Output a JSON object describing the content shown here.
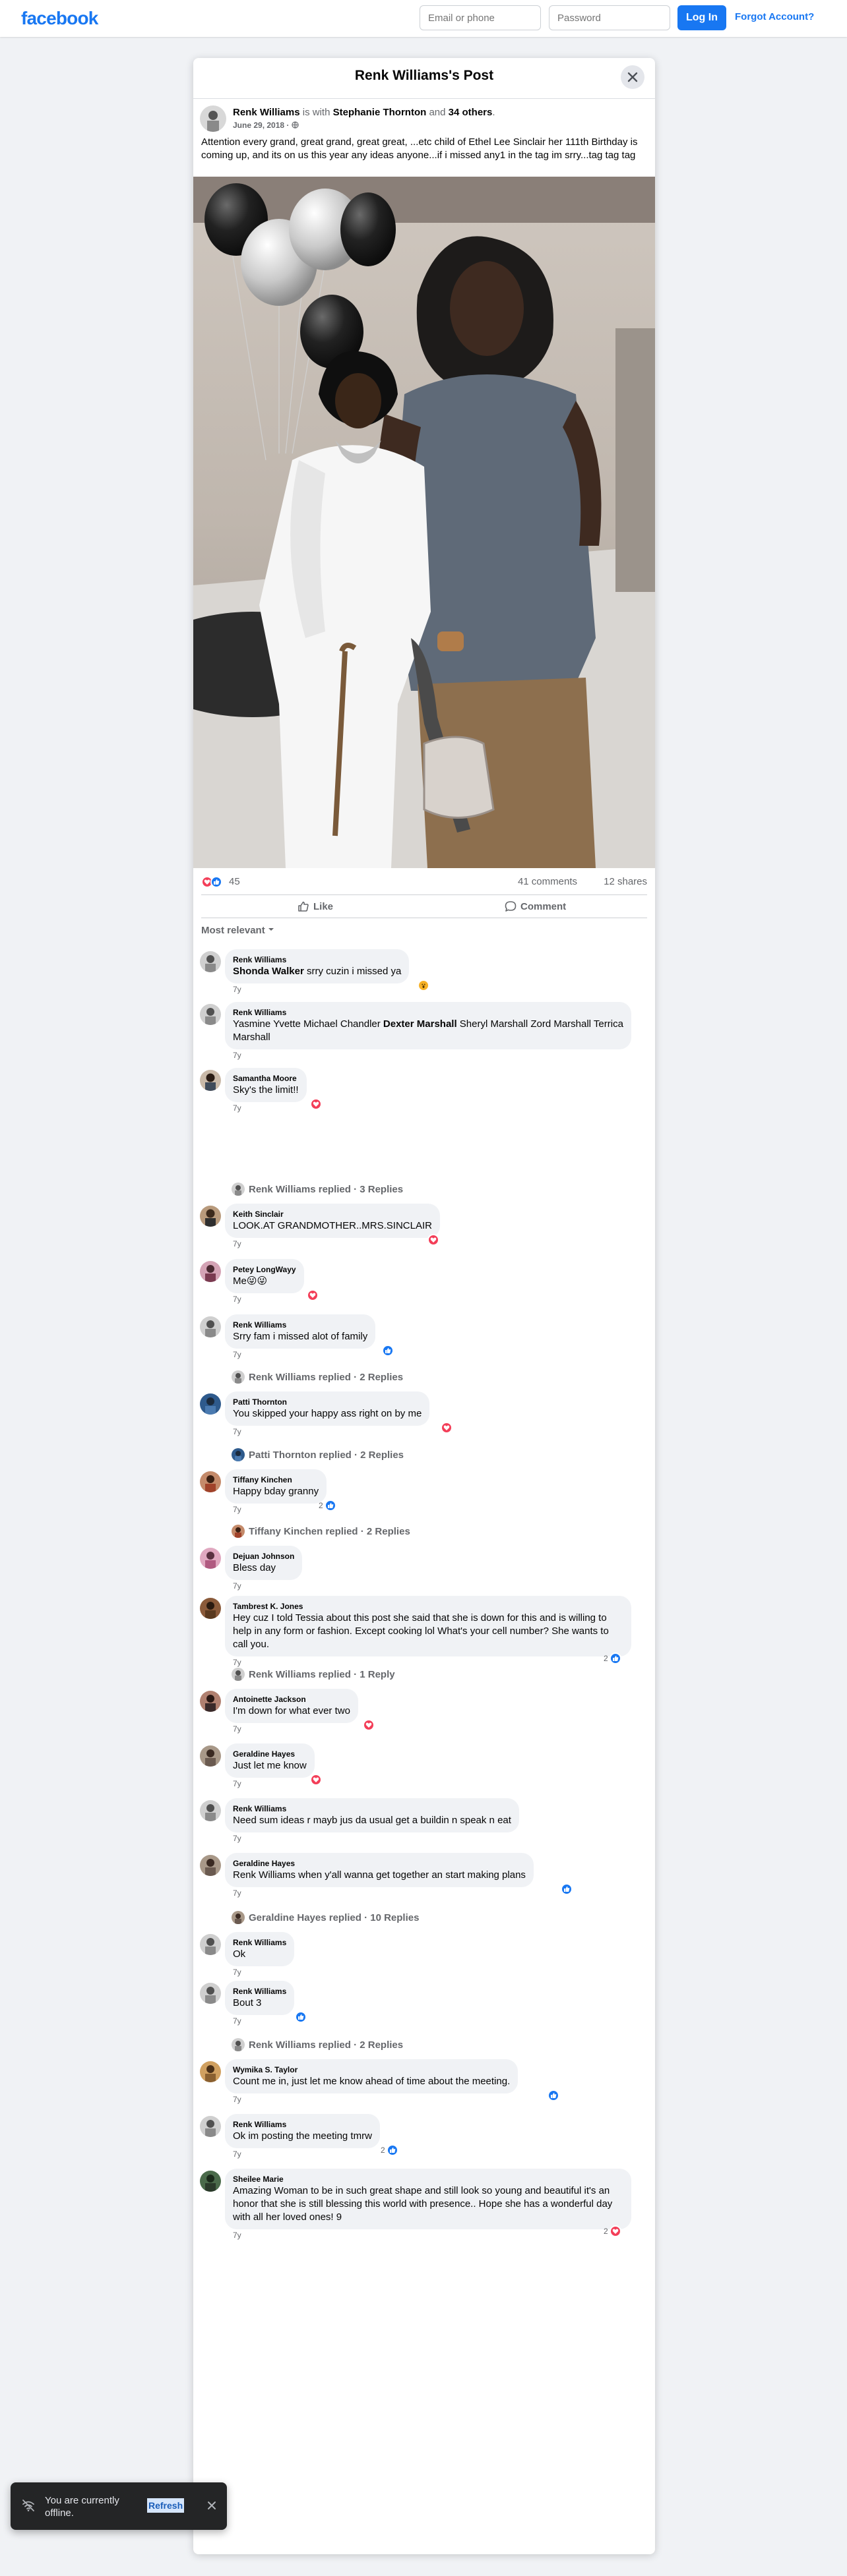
{
  "topbar": {
    "logo": "facebook",
    "email_placeholder": "Email or phone",
    "password_placeholder": "Password",
    "login_label": "Log In",
    "forgot_label": "Forgot Account?"
  },
  "post": {
    "title": "Renk Williams's Post",
    "author": "Renk Williams",
    "with_word": "is with",
    "tagged": "Stephanie Thornton",
    "and_word": "and",
    "others": "34 others",
    "date": "June 29, 2018",
    "text": "Attention every grand, great grand, great great, ...etc child of Ethel Lee Sinclair her 111th  Birthday is coming up, and its on us this year  any ideas anyone...if i missed any1 in the tag im srry...tag tag tag",
    "reaction_count": "45",
    "comments_count": "41 comments",
    "shares_count": "12 shares",
    "like_label": "Like",
    "comment_label": "Comment",
    "sort_label": "Most relevant"
  },
  "comments": [
    {
      "name": "Renk Williams",
      "mention": "Shonda Walker",
      "text": " srry cuzin i missed ya",
      "time": "7y",
      "reaction": "wow"
    },
    {
      "name": "Renk Williams",
      "text_a": "Yasmine Yvette Michael Chandler ",
      "mention": "Dexter Marshall",
      "text_b": " Sheryl Marshall Zord Marshall Terrica Marshall",
      "time": "7y"
    },
    {
      "name": "Samantha Moore",
      "text": "Sky's the limit!!",
      "time": "7y",
      "reaction": "love"
    },
    {
      "name": "Keith Sinclair",
      "text": "LOOK.AT GRANDMOTHER..MRS.SINCLAIR",
      "time": "7y",
      "reaction": "love"
    },
    {
      "name": "Petey LongWayy",
      "text": "Me😜😜",
      "time": "7y",
      "reaction": "love"
    },
    {
      "name": "Renk Williams",
      "text": "Srry fam i missed alot of family",
      "time": "7y",
      "reaction": "like"
    },
    {
      "name": "Patti Thornton",
      "text": "You skipped your happy ass right on by me",
      "time": "7y",
      "reaction": "love"
    },
    {
      "name": "Tiffany Kinchen",
      "text": "Happy bday granny",
      "time": "7y",
      "reaction": "like",
      "reaction_count": "2"
    },
    {
      "name": "Dejuan Johnson",
      "text": "Bless day",
      "time": "7y"
    },
    {
      "name": "Tambrest K. Jones",
      "text": "Hey cuz I told Tessia about this post she said that she is down for this and is willing to help in any form or fashion. Except cooking lol What's your cell number? She wants to call you.",
      "time": "7y",
      "reaction": "like",
      "reaction_count": "2"
    },
    {
      "name": "Antoinette Jackson",
      "text": "I'm down for what ever two",
      "time": "7y",
      "reaction": "love"
    },
    {
      "name": "Geraldine Hayes",
      "text": "Just let me know",
      "time": "7y",
      "reaction": "love"
    },
    {
      "name": "Renk Williams",
      "text": "Need sum ideas r mayb jus da usual get a buildin n speak n eat",
      "time": "7y"
    },
    {
      "name": "Geraldine Hayes",
      "text": "Renk Williams when y'all wanna get together an start making plans",
      "time": "7y",
      "reaction": "like"
    },
    {
      "name": "Renk Williams",
      "text": "Ok",
      "time": "7y"
    },
    {
      "name": "Renk Williams",
      "text": "Bout 3",
      "time": "7y",
      "reaction": "like"
    },
    {
      "name": "Wymika S. Taylor",
      "text": "Count me in, just let me know ahead of time about the meeting.",
      "time": "7y",
      "reaction": "like"
    },
    {
      "name": "Renk Williams",
      "text": "Ok im posting the meeting tmrw",
      "time": "7y",
      "reaction": "like",
      "reaction_count": "2"
    },
    {
      "name": "Sheilee Marie",
      "text": "Amazing Woman to be in such great shape and still look so young and beautiful it's an honor that she is still blessing this world with presence.. Hope she has a wonderful day with all her loved ones! 9",
      "time": "7y",
      "reaction": "love",
      "reaction_count": "2"
    }
  ],
  "reply_links": [
    "Renk Williams replied · 3 Replies",
    "Renk Williams replied · 2 Replies",
    "Patti Thornton replied · 2 Replies",
    "Tiffany Kinchen replied · 2 Replies",
    "Renk Williams replied · 1 Reply",
    "Geraldine Hayes replied · 10 Replies",
    "Renk Williams replied · 2 Replies"
  ],
  "toast": {
    "text": "You are currently offline.",
    "refresh_label": "Refresh"
  },
  "colors": {
    "brand_blue": "#1877f2",
    "love_red": "#f33e58",
    "wow_yellow": "#f7b125",
    "page_bg": "#f0f2f5"
  }
}
